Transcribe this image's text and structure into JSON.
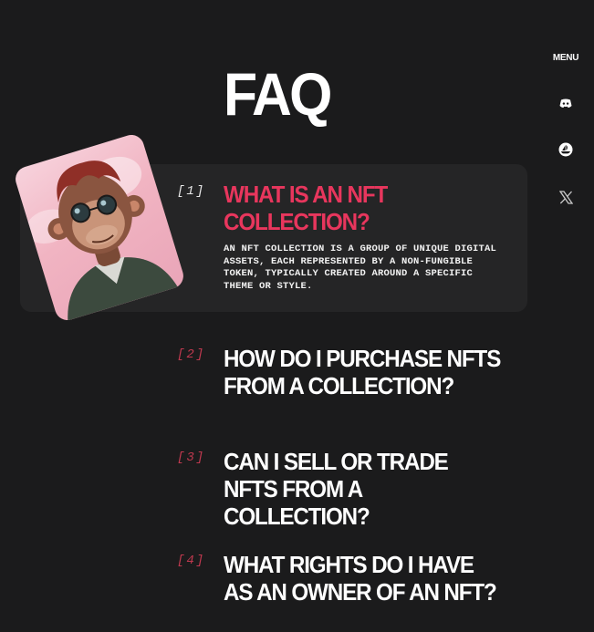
{
  "page": {
    "title": "FAQ"
  },
  "nav": {
    "menu_label": "MENU",
    "icons": [
      "discord-icon",
      "opensea-boat-icon",
      "x-twitter-icon"
    ]
  },
  "faq": [
    {
      "number": "[1]",
      "question": "WHAT IS AN NFT COLLECTION?",
      "answer": "AN NFT COLLECTION IS A GROUP OF UNIQUE DIGITAL ASSETS, EACH REPRESENTED BY A NON-FUNGIBLE TOKEN, TYPICALLY CREATED AROUND A SPECIFIC THEME OR STYLE.",
      "expanded": true
    },
    {
      "number": "[2]",
      "question": "HOW DO I PURCHASE NFTS FROM A COLLECTION?",
      "expanded": false
    },
    {
      "number": "[3]",
      "question": "CAN I SELL OR TRADE NFTS FROM A COLLECTION?",
      "expanded": false
    },
    {
      "number": "[4]",
      "question": "WHAT RIGHTS DO I HAVE AS AN OWNER OF AN NFT?",
      "expanded": false
    }
  ],
  "colors": {
    "background": "#1b1b1c",
    "card": "#252526",
    "accent": "#e8365d",
    "muted_number": "#c0394f",
    "text": "#ffffff"
  }
}
